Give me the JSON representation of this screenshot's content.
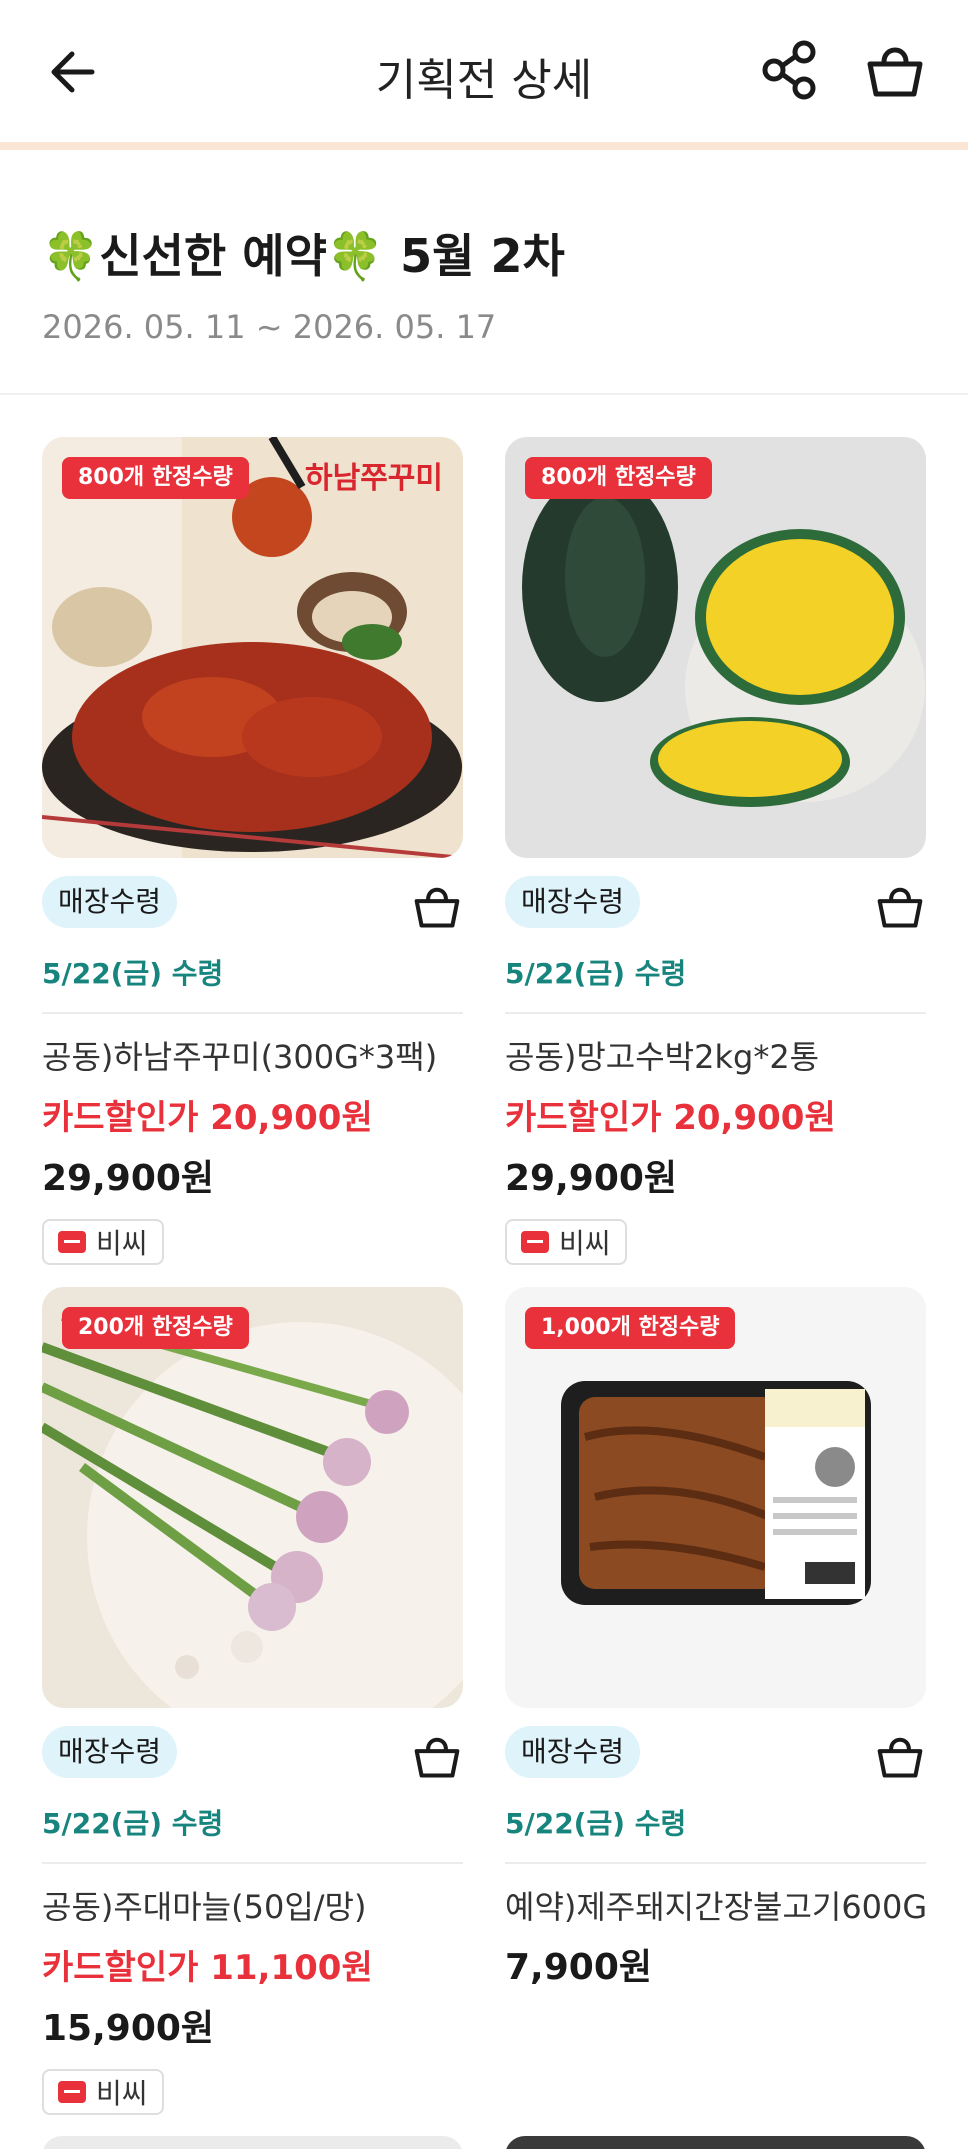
{
  "header": {
    "title": "기획전 상세",
    "back_icon": "back-arrow-icon",
    "share_icon": "share-icon",
    "cart_icon": "shopping-basket-icon"
  },
  "event": {
    "title": "🍀신선한 예약🍀 5월 2차",
    "date_range": "2026. 05. 11 ~ 2026. 05. 17"
  },
  "colors": {
    "accent_red": "#e8313b",
    "pickup_bg": "#dff3fb",
    "date_teal": "#17857d",
    "header_line": "#fbe6d6"
  },
  "products": [
    {
      "badge": "800개 한정수량",
      "brand_overlay": "하남쭈꾸미",
      "pickup": "매장수령",
      "pickup_date": "5/22(금) 수령",
      "name": "공동)하남주꾸미(300G*3팩)",
      "sale_price": "카드할인가 20,900원",
      "price": "29,900원",
      "card_tag": "비씨"
    },
    {
      "badge": "800개 한정수량",
      "pickup": "매장수령",
      "pickup_date": "5/22(금) 수령",
      "name": "공동)망고수박2kg*2통",
      "sale_price": "카드할인가 20,900원",
      "price": "29,900원",
      "card_tag": "비씨"
    },
    {
      "badge": "200개 한정수량",
      "pickup": "매장수령",
      "pickup_date": "5/22(금) 수령",
      "name": "공동)주대마늘(50입/망)",
      "sale_price": "카드할인가 11,100원",
      "price": "15,900원",
      "card_tag": "비씨"
    },
    {
      "badge": "1,000개 한정수량",
      "pickup": "매장수령",
      "pickup_date": "5/22(금) 수령",
      "name": "예약)제주돼지간장불고기600G",
      "price": "7,900원"
    }
  ]
}
